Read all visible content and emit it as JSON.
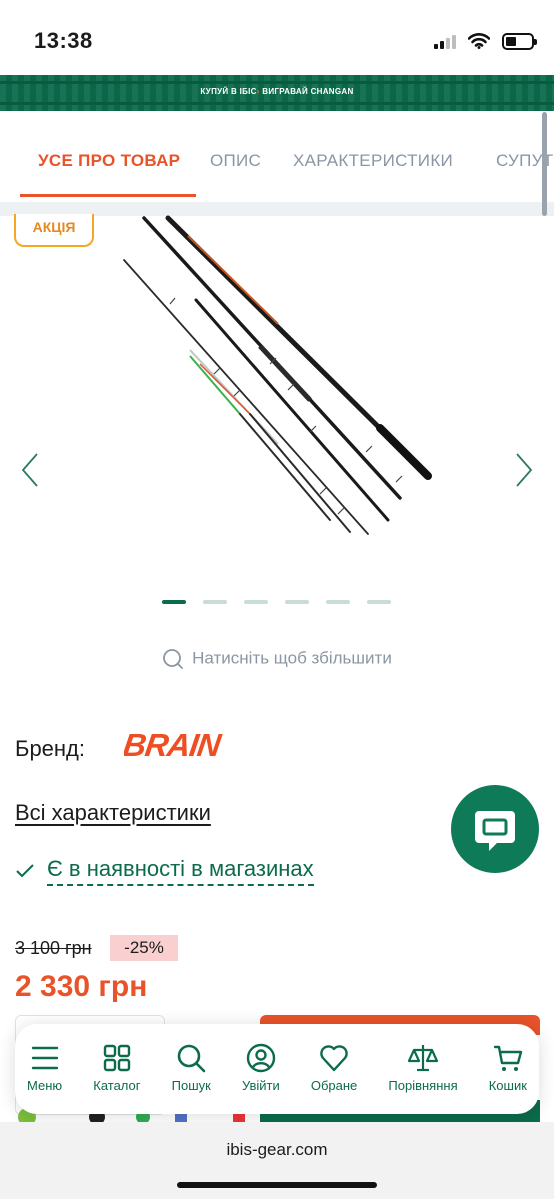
{
  "status": {
    "time": "13:38"
  },
  "promo": {
    "part1": "КУПУЙ В ІБІС",
    "arrow": "›",
    "part2": "ВИГРАВАЙ CHANGAN"
  },
  "tabs": [
    {
      "label": "УСЕ ПРО ТОВАР",
      "active": true
    },
    {
      "label": "ОПИС",
      "active": false
    },
    {
      "label": "ХАРАКТЕРИСТИКИ",
      "active": false
    },
    {
      "label": "СУПУТ",
      "active": false
    }
  ],
  "gallery": {
    "badge": "АКЦІЯ",
    "slide_count": 6,
    "active_slide": 1,
    "zoom_hint": "Натисніть щоб збільшити"
  },
  "brand": {
    "label": "Бренд:",
    "logo_text": "BRAIN"
  },
  "links": {
    "all_specs": "Всі характеристики",
    "availability": "Є в наявності в магазинах"
  },
  "price": {
    "old": "3 100 грн",
    "discount": "-25%",
    "current": "2 330 грн"
  },
  "bottom_nav": [
    {
      "label": "Меню",
      "icon": "menu-icon"
    },
    {
      "label": "Каталог",
      "icon": "grid-icon"
    },
    {
      "label": "Пошук",
      "icon": "search-icon"
    },
    {
      "label": "Увійти",
      "icon": "user-icon"
    },
    {
      "label": "Обране",
      "icon": "heart-icon"
    },
    {
      "label": "Порівняння",
      "icon": "scales-icon"
    },
    {
      "label": "Кошик",
      "icon": "cart-icon"
    }
  ],
  "browser": {
    "url": "ibis-gear.com"
  },
  "colors": {
    "brand_green": "#0c6b4c",
    "accent_orange": "#e8532a",
    "badge_orange": "#f5a623"
  }
}
